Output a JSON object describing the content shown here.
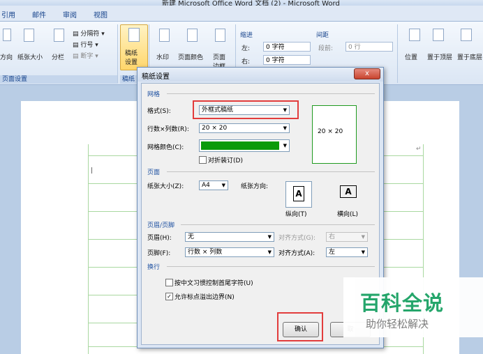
{
  "window": {
    "title": "新建 Microsoft Office Word 文档 (2) - Microsoft Word"
  },
  "tabs": [
    "引用",
    "邮件",
    "审阅",
    "视图"
  ],
  "ribbon": {
    "page_setup": {
      "orientation": "方向",
      "size": "纸张大小",
      "columns": "分栏",
      "breaks": "分隔符",
      "line_numbers": "行号",
      "hyphenation": "断字",
      "label": "页面设置"
    },
    "draft": {
      "button_line1": "稿纸",
      "button_line2": "设置",
      "label": "稿纸"
    },
    "background": {
      "watermark": "水印",
      "page_color": "页面颜色",
      "page_borders_line1": "页面",
      "page_borders_line2": "边框"
    },
    "paragraph": {
      "indent_title": "缩进",
      "indent_left_label": "左:",
      "indent_left_value": "0 字符",
      "indent_right_label": "右:",
      "indent_right_value": "0 字符",
      "spacing_title": "间距",
      "spacing_before_label": "段前:",
      "spacing_before_value": "0 行"
    },
    "arrange": {
      "position": "位置",
      "bring_front": "置于顶层",
      "send_back": "置于底层"
    }
  },
  "dialog": {
    "title": "稿纸设置",
    "close": "x",
    "grid_section": "网格",
    "style_label": "格式(S):",
    "style_value": "外框式稿纸",
    "rowcol_label": "行数×列数(R):",
    "rowcol_value": "20 × 20",
    "preview": "20 × 20",
    "grid_color_label": "网格颜色(C):",
    "grid_color": "#0a9a0a",
    "fold_label": "对折装订(D)",
    "fold_checked": false,
    "page_section": "页面",
    "paper_size_label": "纸张大小(Z):",
    "paper_size_value": "A4",
    "orientation_label": "纸张方向:",
    "portrait_label": "纵向(T)",
    "landscape_label": "横向(L)",
    "hf_section": "页眉/页脚",
    "header_label": "页眉(H):",
    "header_value": "无",
    "header_align_label": "对齐方式(G):",
    "header_align_value": "右",
    "footer_label": "页脚(F):",
    "footer_value": "行数 × 列数",
    "footer_align_label": "对齐方式(A):",
    "footer_align_value": "左",
    "wrap_section": "换行",
    "wrap1_label": "按中文习惯控制首尾字符(U)",
    "wrap1_checked": false,
    "wrap2_label": "允许标点溢出边界(N)",
    "wrap2_checked": true,
    "ok": "确认",
    "cancel": "取"
  },
  "watermark": {
    "title": "百科全说",
    "subtitle": "助你轻松解决"
  }
}
